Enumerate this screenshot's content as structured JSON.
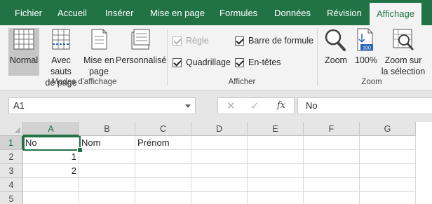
{
  "tabs": [
    {
      "label": "Fichier"
    },
    {
      "label": "Accueil"
    },
    {
      "label": "Insérer"
    },
    {
      "label": "Mise en page"
    },
    {
      "label": "Formules"
    },
    {
      "label": "Données"
    },
    {
      "label": "Révision"
    },
    {
      "label": "Affichage"
    }
  ],
  "active_tab": "Affichage",
  "ribbon": {
    "modes": {
      "group_label": "Modes d'affichage",
      "normal": "Normal",
      "page_breaks": [
        "Avec sauts",
        "de page"
      ],
      "page_layout": [
        "Mise en",
        "page"
      ],
      "custom": "Personnalisé"
    },
    "show": {
      "group_label": "Afficher",
      "ruler": {
        "label": "Règle",
        "checked": true,
        "disabled": true
      },
      "formula_bar": {
        "label": "Barre de formule",
        "checked": true
      },
      "gridlines": {
        "label": "Quadrillage",
        "checked": true
      },
      "headings": {
        "label": "En-têtes",
        "checked": true
      }
    },
    "zoom": {
      "group_label": "Zoom",
      "zoom": "Zoom",
      "hundred": "100%",
      "hundred_badge": "100",
      "zoom_selection": [
        "Zoom sur",
        "la sélection"
      ]
    }
  },
  "formula_bar": {
    "name_box": "A1",
    "cancel_icon": "✕",
    "enter_icon": "✓",
    "fx": "fx",
    "value": "No"
  },
  "grid": {
    "columns": [
      "A",
      "B",
      "C",
      "D",
      "E",
      "F",
      "G"
    ],
    "rows": [
      "1",
      "2",
      "3",
      "4",
      "5"
    ],
    "active_cell": "A1",
    "cells": {
      "A1": "No",
      "B1": "Nom",
      "C1": "Prénom",
      "A2": "1",
      "A3": "2"
    }
  },
  "colors": {
    "accent": "#217346",
    "ribbon_bg": "#f3f3f3",
    "header_bg": "#e6e6e6"
  }
}
